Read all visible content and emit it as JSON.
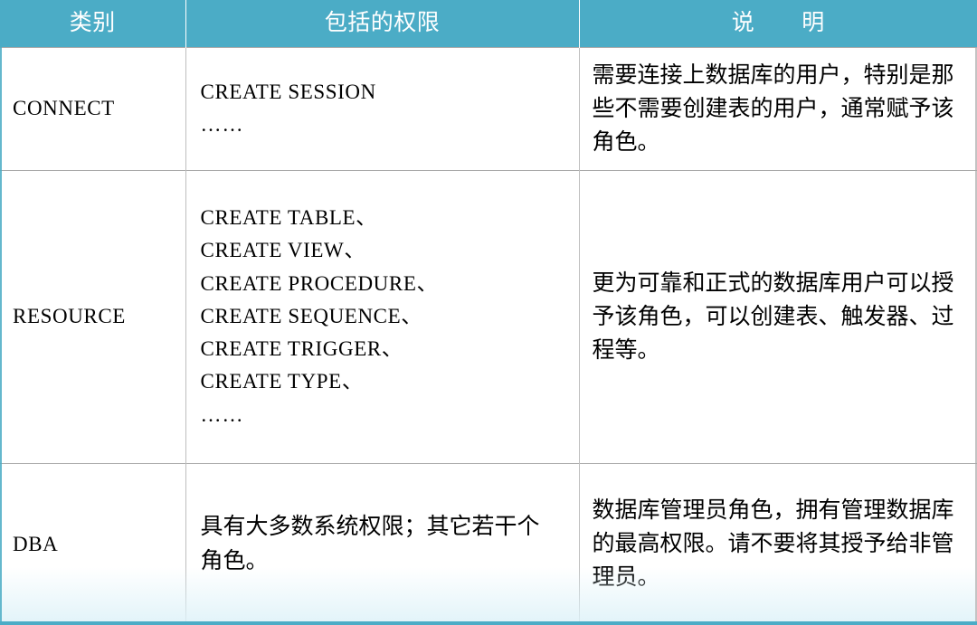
{
  "table": {
    "headers": {
      "category": "类别",
      "privileges": "包括的权限",
      "description_part1": "说",
      "description_part2": "明"
    },
    "accent_color": "#4BACC6",
    "header_text_color": "#FFFFFF",
    "grid_line_color": "#A9A9A9",
    "ellipsis": "……",
    "rows": [
      {
        "category": "CONNECT",
        "privilege_lines": [
          "CREATE SESSION"
        ],
        "privilege_has_ellipsis": true,
        "description": "需要连接上数据库的用户，特别是那些不需要创建表的用户，通常赋予该角色。"
      },
      {
        "category": "RESOURCE",
        "privilege_lines": [
          "CREATE TABLE、",
          "CREATE VIEW、",
          "CREATE PROCEDURE、",
          "CREATE SEQUENCE、",
          "CREATE TRIGGER、",
          "CREATE TYPE、"
        ],
        "privilege_has_ellipsis": true,
        "description": "更为可靠和正式的数据库用户可以授予该角色，可以创建表、触发器、过程等。"
      },
      {
        "category": "DBA",
        "privilege_text_cn": "具有大多数系统权限；其它若干个角色。",
        "privilege_has_ellipsis": false,
        "description": "数据库管理员角色，拥有管理数据库的最高权限。请不要将其授予给非管理员。"
      }
    ]
  }
}
